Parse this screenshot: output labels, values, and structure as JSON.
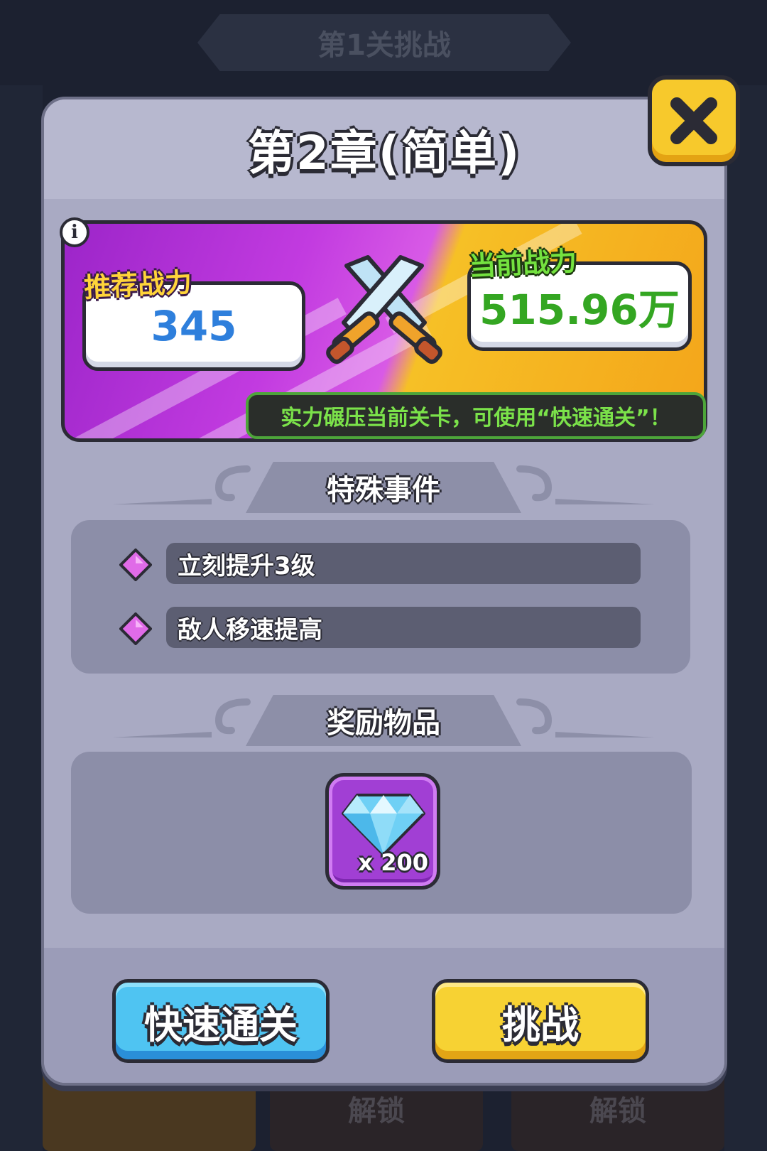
{
  "background": {
    "top_banner": "第1关挑战",
    "locked_cards": [
      "解锁",
      "解锁"
    ]
  },
  "modal": {
    "title": "第2章(简单)",
    "close_icon": "close-x-icon"
  },
  "power": {
    "recommended_label": "推荐战力",
    "recommended_value": "345",
    "current_label": "当前战力",
    "current_value": "515.96万",
    "hint": "实力碾压当前关卡，可使用“快速通关”！",
    "info_icon": "i"
  },
  "events": {
    "header": "特殊事件",
    "items": [
      {
        "label": "立刻提升3级",
        "icon": "purple-gem-bullet"
      },
      {
        "label": "敌人移速提高",
        "icon": "purple-gem-bullet"
      }
    ]
  },
  "rewards": {
    "header": "奖励物品",
    "items": [
      {
        "icon": "diamond-icon",
        "count": "x 200"
      }
    ]
  },
  "buttons": {
    "quick_clear": "快速通关",
    "challenge": "挑战"
  },
  "colors": {
    "quick_button": "#4fc4f2",
    "challenge_button": "#f7d233",
    "close_button": "#f7c92c",
    "current_power": "#34a622",
    "recommended_power": "#2e7fdc"
  }
}
